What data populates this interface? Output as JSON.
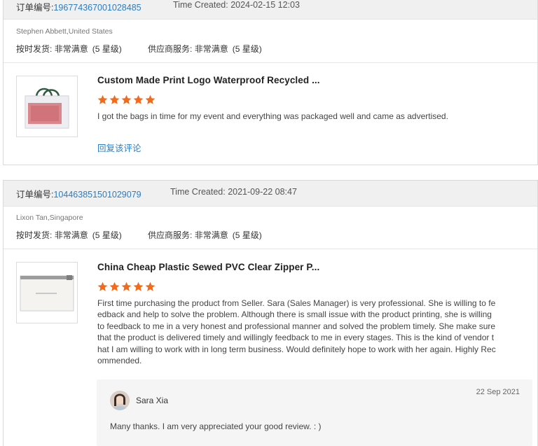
{
  "orders": [
    {
      "order_label": "订单编号:",
      "order_number": "196774367001028485",
      "time_created": "Time Created: 2024-02-15 12:03",
      "buyer": "Stephen Abbett,United States",
      "on_time_label": "按时发货:",
      "on_time_value": "非常满意",
      "on_time_stars": "(5 星级)",
      "supplier_label": "供应商服务:",
      "supplier_value": "非常满意",
      "supplier_stars": "(5 星级)",
      "product_title": "Custom Made Print Logo Waterproof Recycled ...",
      "rating": 5,
      "review": "I got the bags in time for my event and everything was packaged well and came as advertised.",
      "reply_link": "回复该评论",
      "product_icon": "tote-bag-thumbnail"
    },
    {
      "order_label": "订单编号:",
      "order_number": "104463851501029079",
      "time_created": "Time Created: 2021-09-22 08:47",
      "buyer": "Lixon Tan,Singapore",
      "on_time_label": "按时发货:",
      "on_time_value": "非常满意",
      "on_time_stars": "(5 星级)",
      "supplier_label": "供应商服务:",
      "supplier_value": "非常满意",
      "supplier_stars": "(5 星级)",
      "product_title": "China Cheap Plastic Sewed PVC Clear Zipper P...",
      "rating": 5,
      "review_lines": [
        "First time purchasing the product from Seller. Sara (Sales Manager) is very professional. She is willing to fe",
        "edback and help to solve the problem. Although there is small issue with the product printing, she is willing",
        "to feedback to me in a very honest and professional manner and solved the problem timely. She make sure",
        "that the product is delivered timely and willingly feedback to me in every stages. This is the kind of vendor t",
        "hat I am willing to work with in long term business. Would definitely hope to work with her again. Highly Rec",
        "ommended."
      ],
      "product_icon": "zipper-pouch-thumbnail",
      "reply": {
        "name": "Sara Xia",
        "date": "22 Sep 2021",
        "text": "Many thanks. I am very appreciated your good review. : )"
      }
    }
  ],
  "colors": {
    "link": "#2a7dc2",
    "star": "#f26a1b",
    "header_bg": "#f0f0f0"
  }
}
